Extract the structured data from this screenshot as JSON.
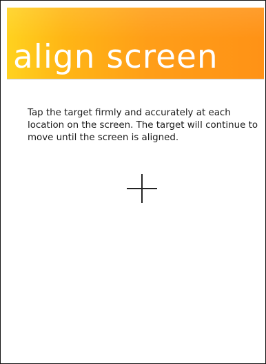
{
  "header": {
    "title": "align screen"
  },
  "instructions": {
    "text": "Tap the target firmly and accurately at each location on the screen. The target will continue to move until the screen is aligned."
  },
  "target": {
    "icon": "crosshair-icon"
  }
}
